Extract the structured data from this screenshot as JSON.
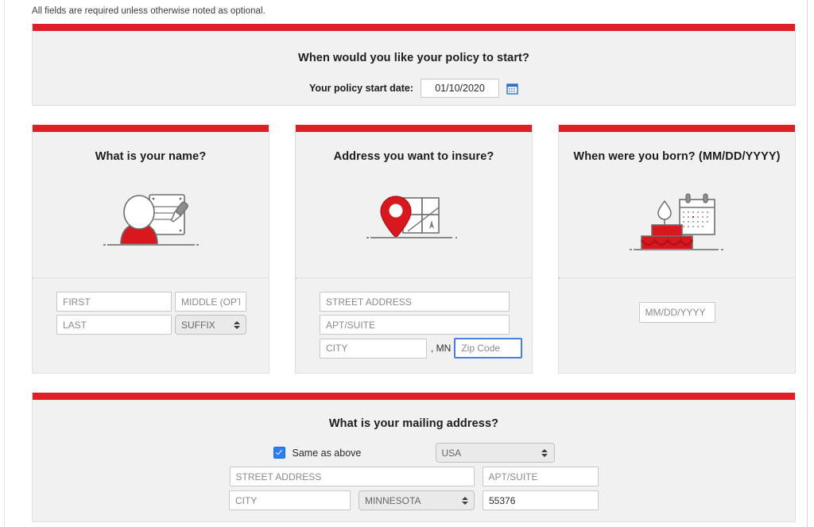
{
  "notice": "All fields are required unless otherwise noted as optional.",
  "theme": {
    "accent_red": "#DF1F26",
    "card_bg": "#F1F1F1",
    "focus_blue": "#4A7DE8",
    "checkbox_blue": "#2A7EF0"
  },
  "policy_section": {
    "title": "When would you like your policy to start?",
    "date_label": "Your policy start date:",
    "date_value": "01/10/2020",
    "calendar_icon": "calendar-icon"
  },
  "name_card": {
    "title": "What is your name?",
    "illustration": "person-with-clipboard-illustration",
    "first_placeholder": "FIRST",
    "first_value": "",
    "middle_placeholder": "MIDDLE (OPTIONAL)",
    "middle_value": "",
    "last_placeholder": "LAST",
    "last_value": "",
    "suffix_selected": "SUFFIX"
  },
  "address_card": {
    "title": "Address you want to insure?",
    "illustration": "map-pin-illustration",
    "street_placeholder": "STREET ADDRESS",
    "street_value": "",
    "apt_placeholder": "APT/SUITE",
    "apt_value": "",
    "city_placeholder": "CITY",
    "city_value": "",
    "state_abbr": ", MN",
    "zip_placeholder": "Zip Code",
    "zip_value": ""
  },
  "dob_card": {
    "title": "When were you born? (MM/DD/YYYY)",
    "illustration": "birthday-cake-calendar-illustration",
    "dob_placeholder": "MM/DD/YYYY",
    "dob_value": ""
  },
  "mailing_card": {
    "title": "What is your mailing address?",
    "same_as_above_label": "Same as above",
    "same_as_above_checked": true,
    "country_selected": "USA",
    "street_placeholder": "STREET ADDRESS",
    "street_value": "",
    "apt_placeholder": "APT/SUITE",
    "apt_value": "",
    "city_placeholder": "CITY",
    "city_value": "",
    "state_selected": "MINNESOTA",
    "zip_value": "55376"
  }
}
